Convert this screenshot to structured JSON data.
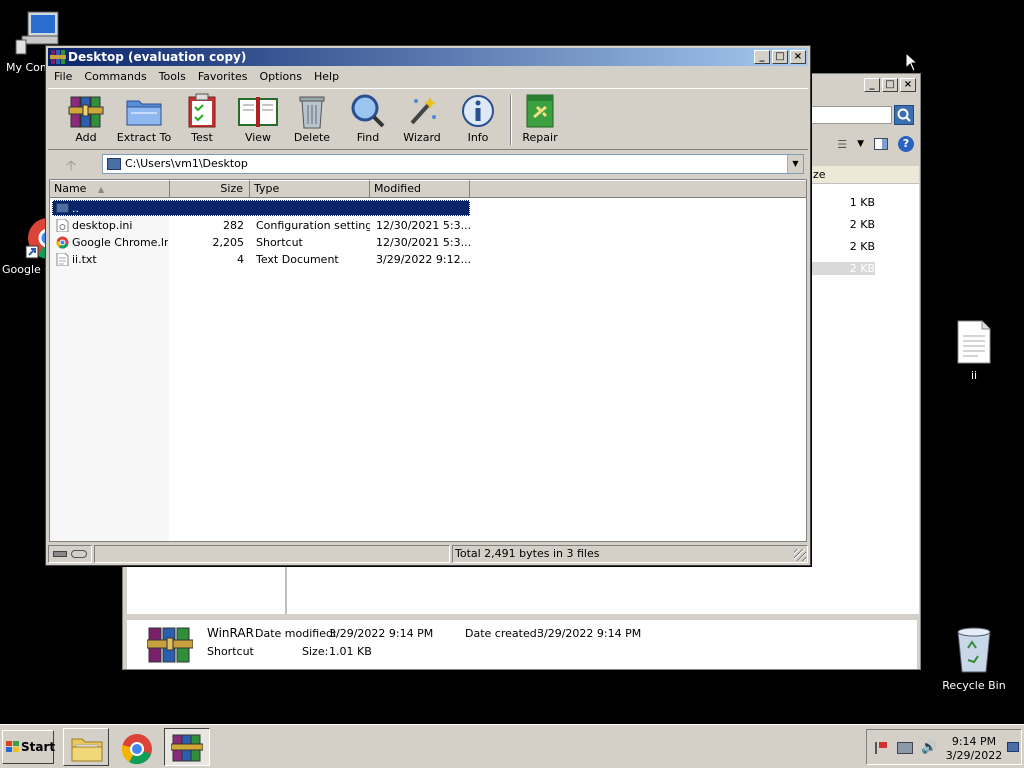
{
  "desktop": {
    "icons": {
      "my_computer": "My Com",
      "chrome": "Google C",
      "file_ii": "ii",
      "recycle_bin": "Recycle Bin"
    }
  },
  "explorer": {
    "size_header": "ze",
    "sizes": [
      "1 KB",
      "2 KB",
      "2 KB",
      "2 KB"
    ],
    "details": {
      "name": "WinRAR",
      "type": "Shortcut",
      "date_modified_label": "Date modified:",
      "date_modified": "3/29/2022 9:14 PM",
      "date_created_label": "Date created:",
      "date_created": "3/29/2022 9:14 PM",
      "size_label": "Size:",
      "size": "1.01 KB"
    }
  },
  "winrar": {
    "title": "Desktop (evaluation copy)",
    "menu": [
      "File",
      "Commands",
      "Tools",
      "Favorites",
      "Options",
      "Help"
    ],
    "toolbar": {
      "add": "Add",
      "extract": "Extract To",
      "test": "Test",
      "view": "View",
      "delete": "Delete",
      "find": "Find",
      "wizard": "Wizard",
      "info": "Info",
      "repair": "Repair"
    },
    "address": "C:\\Users\\vm1\\Desktop",
    "columns": {
      "name": "Name",
      "size": "Size",
      "type": "Type",
      "modified": "Modified"
    },
    "rows": [
      {
        "name": "..",
        "size": "",
        "type": "",
        "modified": ""
      },
      {
        "name": "desktop.ini",
        "size": "282",
        "type": "Configuration settings",
        "modified": "12/30/2021 5:3..."
      },
      {
        "name": "Google Chrome.lnk",
        "size": "2,205",
        "type": "Shortcut",
        "modified": "12/30/2021 5:3..."
      },
      {
        "name": "ii.txt",
        "size": "4",
        "type": "Text Document",
        "modified": "3/29/2022 9:12..."
      }
    ],
    "status": "Total 2,491 bytes in 3 files"
  },
  "taskbar": {
    "start": "Start",
    "time": "9:14 PM",
    "date": "3/29/2022"
  },
  "colors": {
    "title_active": "#0a246a",
    "selection": "#0a246a",
    "chrome_face": "#d4d0c8"
  }
}
